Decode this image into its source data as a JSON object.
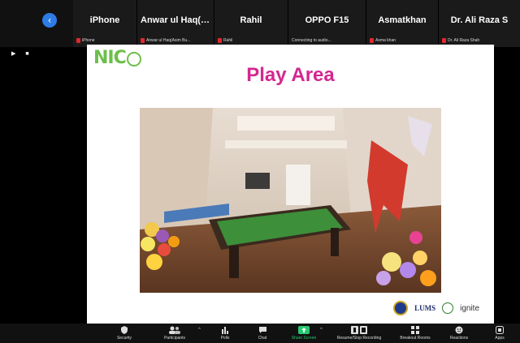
{
  "participants_strip": {
    "tiles": [
      {
        "name": "iPhone",
        "label": "iPhone"
      },
      {
        "name": "Anwar ul Haq(A...",
        "label": "Anwar ul Haq(Asim Bu..."
      },
      {
        "name": "Rahil",
        "label": "Rahil"
      },
      {
        "name": "OPPO F15",
        "label": "Connecting to audio..."
      },
      {
        "name": "Asmatkhan",
        "label": "Asma khan"
      },
      {
        "name": "Dr. Ali Raza S",
        "label": "Dr. Ali Raza Shah"
      }
    ]
  },
  "view_controls": "▶ ■",
  "slide": {
    "logo_text": "NIC",
    "title": "Play Area",
    "footer": {
      "lums": "LUMS",
      "ignite": "ignite"
    }
  },
  "toolbar": {
    "items": [
      {
        "label": "Security",
        "icon": "shield-icon"
      },
      {
        "label": "Participants",
        "icon": "participants-icon",
        "count": "9"
      },
      {
        "label": "Polls",
        "icon": "polls-icon"
      },
      {
        "label": "Chat",
        "icon": "chat-icon"
      },
      {
        "label": "Share Screen",
        "icon": "share-screen-icon"
      },
      {
        "label": "Resume/Stop Recording",
        "icon": "recording-icon"
      },
      {
        "label": "Breakout Rooms",
        "icon": "breakout-icon"
      },
      {
        "label": "Reactions",
        "icon": "reactions-icon"
      },
      {
        "label": "Apps",
        "icon": "apps-icon"
      }
    ]
  },
  "colors": {
    "title": "#d4278f",
    "logo": "#6cbf4b",
    "share_green": "#28c76f",
    "back_button": "#2d7be5",
    "mute_red": "#e0282e"
  }
}
